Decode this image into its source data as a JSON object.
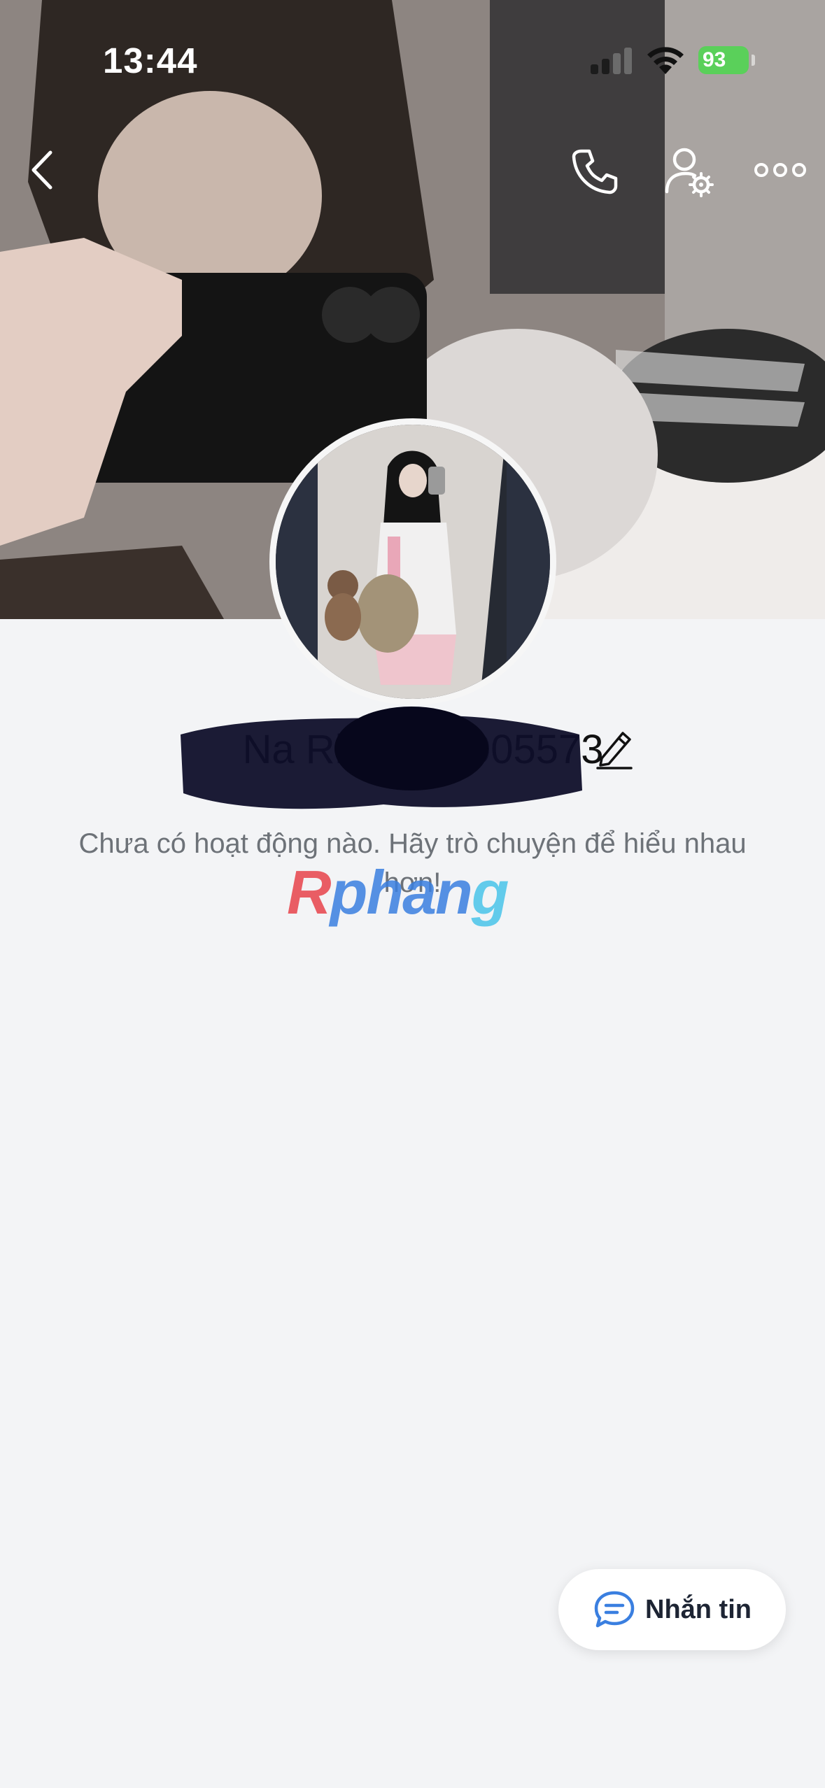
{
  "status_bar": {
    "time": "13:44",
    "battery_level": "93"
  },
  "header": {
    "icons": [
      "back-icon",
      "phone-icon",
      "user-settings-icon",
      "more-icon"
    ]
  },
  "profile": {
    "name": "Na Rin 0123005573",
    "description": "Chưa có hoạt động nào. Hãy trò chuyện để hiểu nhau hơn!"
  },
  "watermark": {
    "part1": "R",
    "part2": "phan",
    "part3": "g"
  },
  "actions": {
    "message_label": "Nhắn tin"
  },
  "colors": {
    "background": "#f3f4f6",
    "battery": "#5ad05a",
    "accent_blue": "#3a7fe0"
  }
}
